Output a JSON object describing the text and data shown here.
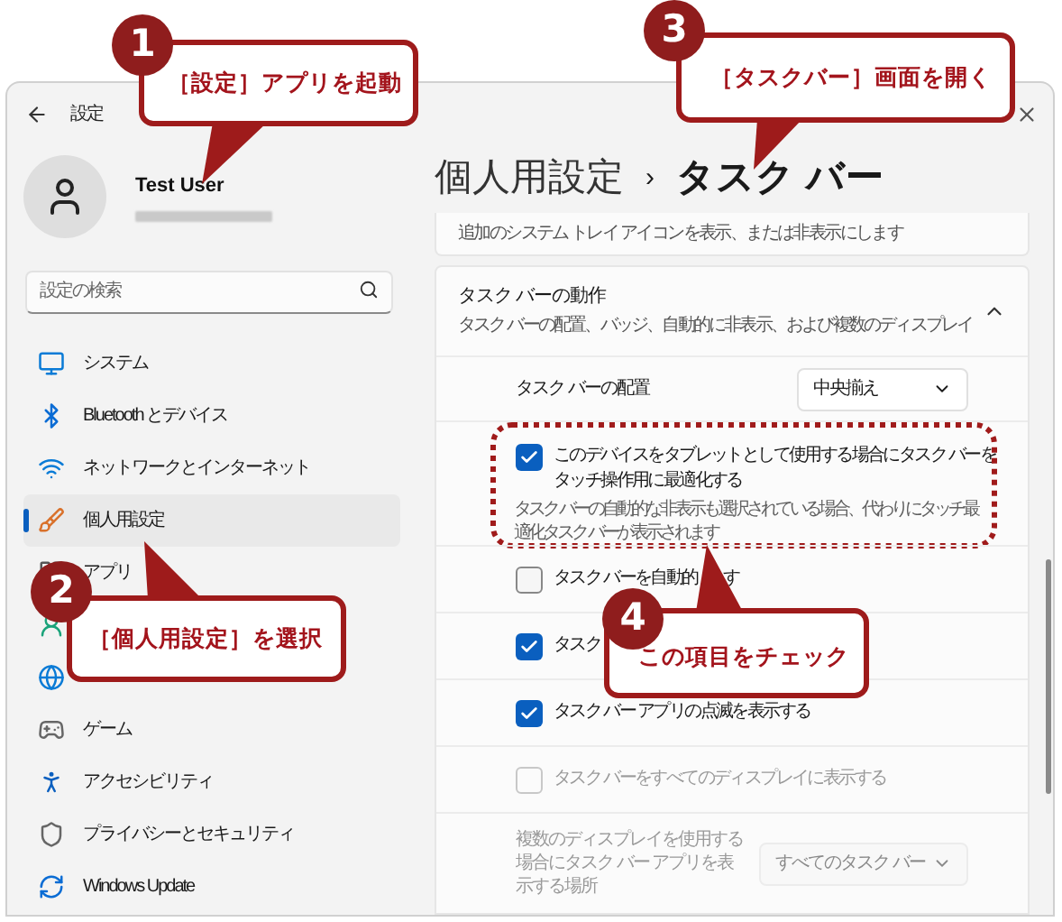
{
  "window": {
    "title": "設定"
  },
  "profile": {
    "name": "Test User"
  },
  "search": {
    "placeholder": "設定の検索"
  },
  "sidebar": {
    "items": [
      {
        "kind": "system",
        "label": "システム",
        "selected": false
      },
      {
        "kind": "bluetooth",
        "label": "Bluetooth とデバイス",
        "selected": false
      },
      {
        "kind": "network",
        "label": "ネットワークとインターネット",
        "selected": false
      },
      {
        "kind": "personalization",
        "label": "個人用設定",
        "selected": true
      },
      {
        "kind": "apps",
        "label": "アプリ",
        "selected": false
      },
      {
        "kind": "accounts",
        "selected": false
      },
      {
        "kind": "time",
        "selected": false
      },
      {
        "kind": "gaming",
        "label": "ゲーム",
        "selected": false
      },
      {
        "kind": "accessibility",
        "label": "アクセシビリティ",
        "selected": false
      },
      {
        "kind": "privacy",
        "label": "プライバシーとセキュリティ",
        "selected": false
      },
      {
        "kind": "update",
        "label": "Windows Update",
        "selected": false
      }
    ]
  },
  "breadcrumb": {
    "parent": "個人用設定",
    "separator": "›",
    "current": "タスク バー"
  },
  "top_card": {
    "subtitle": "追加のシステム トレイ アイコンを表示、または非表示にします"
  },
  "section": {
    "title": "タスク バーの動作",
    "subtitle": "タスク バーの配置、バッジ、自動的に非表示、および複数のディスプレイ",
    "expanded": true,
    "rows": [
      {
        "kind": "dropdown",
        "label": "タスク バーの配置",
        "value": "中央揃え",
        "disabled": false
      },
      {
        "kind": "checkbox",
        "label": "このデバイスをタブレットとして使用する場合にタスク バーをタッチ操作用に最適化する",
        "description": "タスク バーの自動的な非表示も選択されている場合、代わりにタッチ最適化タスク バーが表示されます",
        "checked": true,
        "disabled": false,
        "highlighted": true
      },
      {
        "kind": "checkbox",
        "label": "タスク バーを自動的",
        "label_tail": "す",
        "checked": false,
        "disabled": false,
        "highlighted": false
      },
      {
        "kind": "checkbox",
        "label": "タスク",
        "checked": true,
        "disabled": false,
        "highlighted": false
      },
      {
        "kind": "checkbox",
        "label": "タスク バー アプリの点滅を表示する",
        "checked": true,
        "disabled": false,
        "highlighted": false
      },
      {
        "kind": "checkbox",
        "label": "タスク バーをすべてのディスプレイに表示する",
        "checked": false,
        "disabled": true,
        "highlighted": false
      },
      {
        "kind": "dropdown",
        "label": "複数のディスプレイを使用する場合にタスク バー アプリを表示する場所",
        "value": "すべてのタスク バー",
        "disabled": true
      }
    ]
  },
  "callouts": [
    {
      "number": "1",
      "text": "［設定］アプリを起動"
    },
    {
      "number": "2",
      "text": "［個人用設定］を選択"
    },
    {
      "number": "3",
      "text": "［タスクバー］画面を開く"
    },
    {
      "number": "4",
      "text": "この項目をチェック"
    }
  ]
}
